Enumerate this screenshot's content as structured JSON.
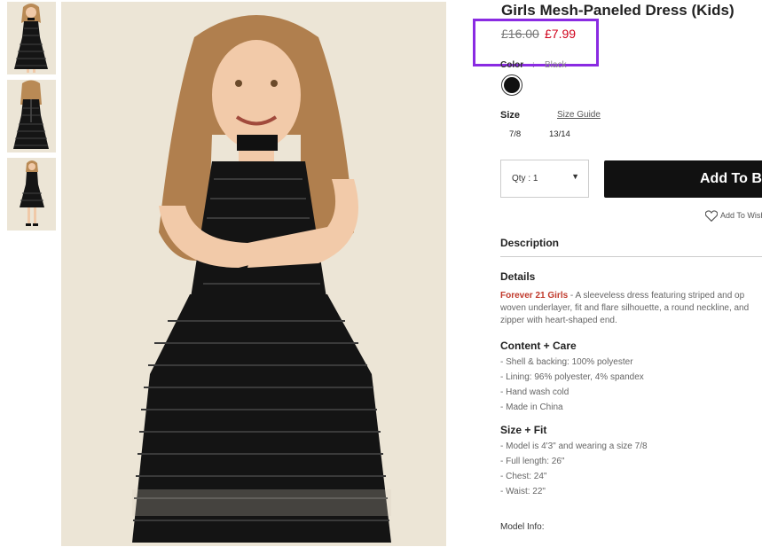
{
  "product": {
    "title": "Girls Mesh-Paneled Dress (Kids)",
    "old_price": "£16.00",
    "sale_price": "£7.99"
  },
  "color": {
    "label": "Color",
    "separator": ":",
    "value": "Black",
    "swatch_hex": "#111111"
  },
  "size": {
    "label": "Size",
    "guide_label": "Size Guide",
    "options": [
      "7/8",
      "13/14"
    ]
  },
  "cart": {
    "qty_label": "Qty : 1",
    "add_label": "Add To Bag",
    "wishlist_label": "Add To Wishlist"
  },
  "description": {
    "heading": "Description"
  },
  "details": {
    "heading": "Details",
    "brand": "Forever 21 Girls",
    "lines": [
      " - A sleeveless dress featuring striped and op",
      "woven underlayer, fit and flare silhouette, a round neckline, and",
      "zipper with heart-shaped end."
    ]
  },
  "content_care": {
    "heading": "Content + Care",
    "items": [
      "- Shell & backing: 100% polyester",
      "- Lining: 96% polyester, 4% spandex",
      "- Hand wash cold",
      "- Made in China"
    ]
  },
  "size_fit": {
    "heading": "Size + Fit",
    "items": [
      "- Model is 4'3\" and wearing a size 7/8",
      "- Full length: 26\"",
      "- Chest: 24\"",
      "- Waist: 22\""
    ]
  },
  "model_info": {
    "label": "Model Info:"
  },
  "colors": {
    "sale": "#d0021b",
    "highlight": "#8a2be2",
    "brand": "#c0392b"
  }
}
